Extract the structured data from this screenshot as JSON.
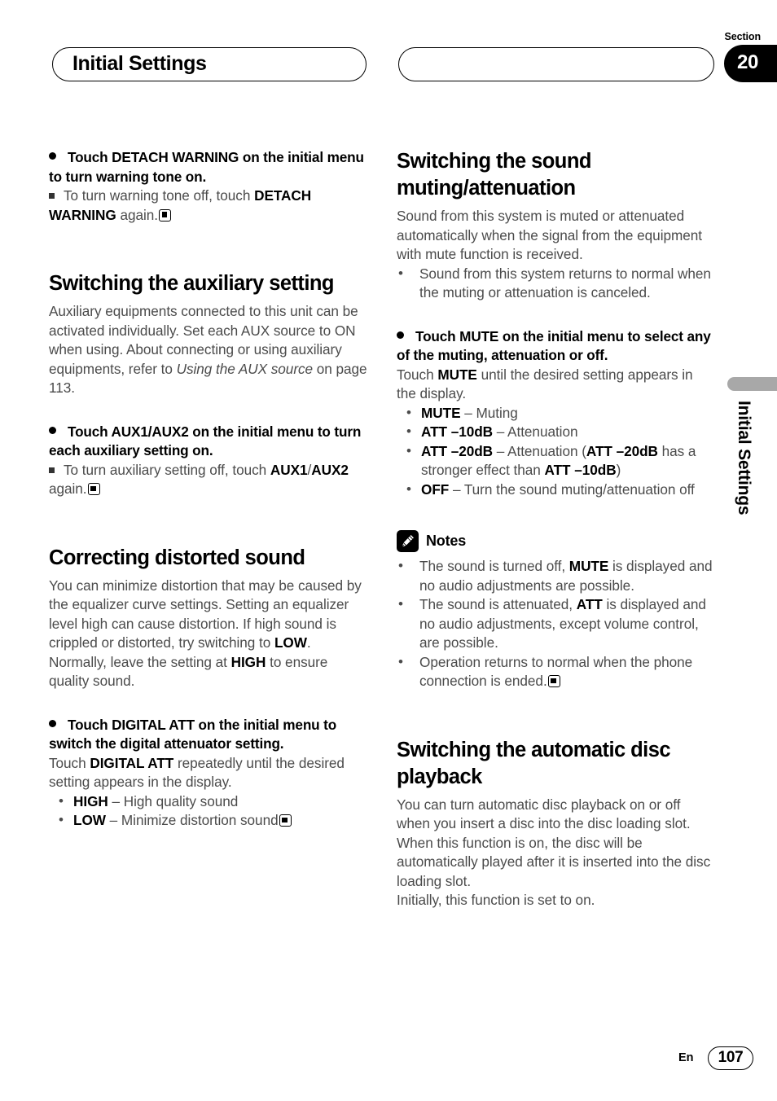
{
  "header": {
    "title": "Initial Settings",
    "right_pill": "",
    "section_label": "Section",
    "section_number": "20"
  },
  "side_tab": {
    "label": "Initial Settings"
  },
  "left_column": {
    "op_detach": {
      "text": "Touch DETACH WARNING on the initial menu to turn warning tone on."
    },
    "sub_detach": {
      "lead": "To turn warning tone off, touch ",
      "bold": "DETACH WARNING",
      "tail": " again."
    },
    "heading_aux": "Switching the auxiliary setting",
    "body_aux_1": "Auxiliary equipments connected to this unit can be activated individually. Set each AUX source to ON when using. About connecting or using auxiliary equipments, refer to ",
    "body_aux_italic": "Using the AUX source",
    "body_aux_2": " on page 113.",
    "op_aux": {
      "text": "Touch AUX1/AUX2 on the initial menu to turn each auxiliary setting on."
    },
    "sub_aux": {
      "lead": "To turn auxiliary setting off, touch ",
      "bold1": "AUX1",
      "slash": "/",
      "bold2": "AUX2",
      "tail": " again."
    },
    "heading_distortion": "Correcting distorted sound",
    "body_distortion_1": "You can minimize distortion that may be caused by the equalizer curve settings. Setting an equalizer level high can cause distortion. If high sound is crippled or distorted, try switching to ",
    "body_distortion_low": "LOW",
    "body_distortion_2": ". Normally, leave the setting at ",
    "body_distortion_high": "HIGH",
    "body_distortion_3": " to ensure quality sound.",
    "op_digital_att": {
      "text": "Touch DIGITAL ATT on the initial menu to switch the digital attenuator setting."
    },
    "body_digital_att_1": "Touch ",
    "body_digital_att_bold": "DIGITAL ATT",
    "body_digital_att_2": " repeatedly until the desired setting appears in the display.",
    "digital_att_options": [
      {
        "term": "HIGH",
        "desc": " – High quality sound",
        "end": false
      },
      {
        "term": "LOW",
        "desc": " – Minimize distortion sound",
        "end": true
      }
    ]
  },
  "right_column": {
    "heading_mute": "Switching the sound muting/attenuation",
    "body_mute_1": "Sound from this system is muted or attenuated automatically when the signal from the equipment with mute function is received.",
    "mute_bullets": [
      "Sound from this system returns to normal when the muting or attenuation is canceled."
    ],
    "op_mute": {
      "text": "Touch MUTE on the initial menu to select any of the muting, attenuation or off."
    },
    "body_mute_2a": "Touch ",
    "body_mute_2b": "MUTE",
    "body_mute_2c": " until the desired setting appears in the display.",
    "mute_options": [
      {
        "term": "MUTE",
        "desc": " – Muting"
      },
      {
        "term": "ATT –10dB",
        "desc": " – Attenuation"
      },
      {
        "term": "ATT –20dB",
        "desc_pre": " – Attenuation (",
        "strong1": "ATT –20dB",
        "desc_mid": " has a stronger effect than ",
        "strong2": "ATT –10dB",
        "desc_post": ")"
      },
      {
        "term": "OFF",
        "desc": " – Turn the sound muting/attenuation off"
      }
    ],
    "notes_label": "Notes",
    "notes_icon": "pencil-icon",
    "notes": [
      {
        "pre": "The sound is turned off, ",
        "bold": "MUTE",
        "post": " is displayed and no audio adjustments are possible.",
        "end": false
      },
      {
        "pre": "The sound is attenuated, ",
        "bold": "ATT",
        "post": " is displayed and no audio adjustments, except volume control, are possible.",
        "end": false
      },
      {
        "pre": "Operation returns to normal when the phone connection is ended.",
        "bold": "",
        "post": "",
        "end": true
      }
    ],
    "heading_autodisc": "Switching the automatic disc playback",
    "body_autodisc_1": "You can turn automatic disc playback on or off when you insert a disc into the disc loading slot. When this function is on, the disc will be automatically played after it is inserted into the disc loading slot.",
    "body_autodisc_2": "Initially, this function is set to on."
  },
  "footer": {
    "language": "En",
    "page_number": "107"
  }
}
